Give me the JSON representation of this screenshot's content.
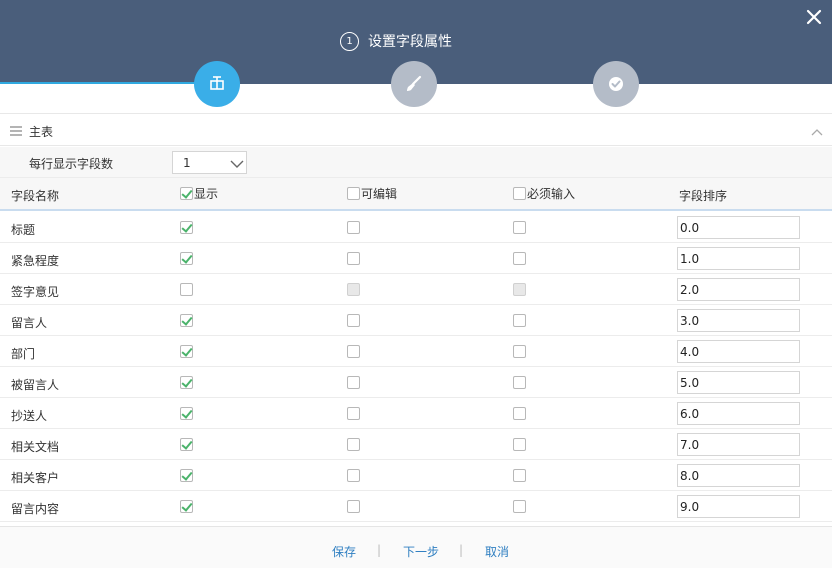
{
  "header": {
    "step_number": "1",
    "title": "设置字段属性"
  },
  "section": {
    "title": "主表"
  },
  "settings": {
    "fields_per_row_label": "每行显示字段数",
    "fields_per_row_value": "1"
  },
  "table": {
    "columns": {
      "name": "字段名称",
      "show": "显示",
      "editable": "可编辑",
      "required": "必须输入",
      "order": "字段排序"
    },
    "rows": [
      {
        "name": "标题",
        "show": true,
        "editable": false,
        "required": false,
        "disabled": false,
        "order": "0.0"
      },
      {
        "name": "紧急程度",
        "show": true,
        "editable": false,
        "required": false,
        "disabled": false,
        "order": "1.0"
      },
      {
        "name": "签字意见",
        "show": false,
        "editable": false,
        "required": false,
        "disabled": true,
        "order": "2.0"
      },
      {
        "name": "留言人",
        "show": true,
        "editable": false,
        "required": false,
        "disabled": false,
        "order": "3.0"
      },
      {
        "name": "部门",
        "show": true,
        "editable": false,
        "required": false,
        "disabled": false,
        "order": "4.0"
      },
      {
        "name": "被留言人",
        "show": true,
        "editable": false,
        "required": false,
        "disabled": false,
        "order": "5.0"
      },
      {
        "name": "抄送人",
        "show": true,
        "editable": false,
        "required": false,
        "disabled": false,
        "order": "6.0"
      },
      {
        "name": "相关文档",
        "show": true,
        "editable": false,
        "required": false,
        "disabled": false,
        "order": "7.0"
      },
      {
        "name": "相关客户",
        "show": true,
        "editable": false,
        "required": false,
        "disabled": false,
        "order": "8.0"
      },
      {
        "name": "留言内容",
        "show": true,
        "editable": false,
        "required": false,
        "disabled": false,
        "order": "9.0"
      }
    ]
  },
  "footer": {
    "save": "保存",
    "next": "下一步",
    "cancel": "取消",
    "separator": "|"
  },
  "colors": {
    "header_bg": "#4a5e7b",
    "accent": "#3aaee8",
    "check": "#4bb36b",
    "link": "#2f7fc1"
  }
}
